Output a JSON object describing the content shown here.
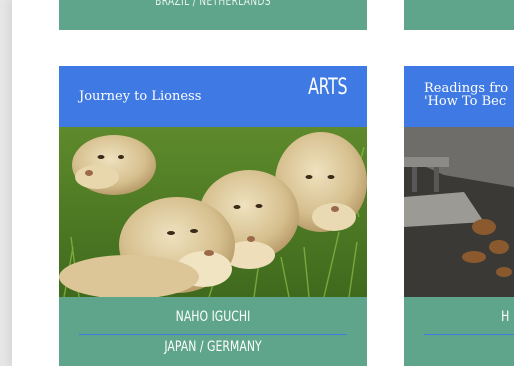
{
  "cards": [
    {
      "top_strip": "BRAZIL / NETHERLANDS",
      "title": "Journey to Lioness",
      "category": "ARTS",
      "artist_name": "NAHO IGUCHI",
      "artist_location": "JAPAN / GERMANY"
    },
    {
      "title_line1": "Readings fro",
      "title_line2": "'How To Bec",
      "name_partial": "H"
    }
  ],
  "colors": {
    "card_blue": "#3f79e3",
    "card_green": "#5fa58c"
  }
}
